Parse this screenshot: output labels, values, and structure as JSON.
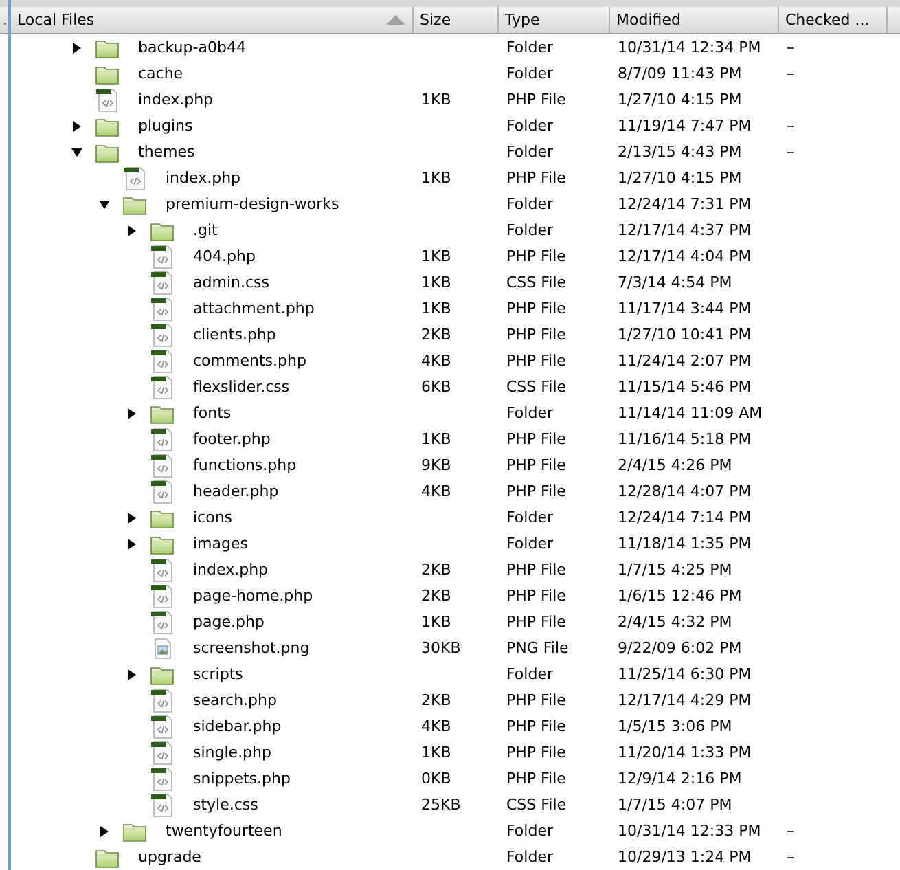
{
  "left_pane": {
    "header": "."
  },
  "columns": [
    {
      "label": "Local Files",
      "sorted": true
    },
    {
      "label": "Size",
      "sorted": false
    },
    {
      "label": "Type",
      "sorted": false
    },
    {
      "label": "Modified",
      "sorted": false
    },
    {
      "label": "Checked ...",
      "sorted": false
    }
  ],
  "tree": [
    {
      "name": "backup-a0b44",
      "kind": "folder",
      "expanded": false,
      "type": "Folder",
      "modified": "10/31/14 12:34 PM",
      "checked": "–"
    },
    {
      "name": "cache",
      "kind": "folder",
      "type": "Folder",
      "modified": "8/7/09 11:43 PM",
      "checked": "–"
    },
    {
      "name": "index.php",
      "kind": "code",
      "size": "1KB",
      "type": "PHP File",
      "modified": "1/27/10 4:15 PM"
    },
    {
      "name": "plugins",
      "kind": "folder",
      "expanded": false,
      "type": "Folder",
      "modified": "11/19/14 7:47 PM",
      "checked": "–"
    },
    {
      "name": "themes",
      "kind": "folder",
      "expanded": true,
      "type": "Folder",
      "modified": "2/13/15 4:43 PM",
      "checked": "–",
      "children": [
        {
          "name": "index.php",
          "kind": "code",
          "size": "1KB",
          "type": "PHP File",
          "modified": "1/27/10 4:15 PM"
        },
        {
          "name": "premium-design-works",
          "kind": "folder",
          "expanded": true,
          "type": "Folder",
          "modified": "12/24/14 7:31 PM",
          "children": [
            {
              "name": ".git",
              "kind": "folder",
              "expanded": false,
              "type": "Folder",
              "modified": "12/17/14 4:37 PM"
            },
            {
              "name": "404.php",
              "kind": "code",
              "size": "1KB",
              "type": "PHP File",
              "modified": "12/17/14 4:04 PM"
            },
            {
              "name": "admin.css",
              "kind": "code",
              "size": "1KB",
              "type": "CSS File",
              "modified": "7/3/14 4:54 PM"
            },
            {
              "name": "attachment.php",
              "kind": "code",
              "size": "1KB",
              "type": "PHP File",
              "modified": "11/17/14 3:44 PM"
            },
            {
              "name": "clients.php",
              "kind": "code",
              "size": "2KB",
              "type": "PHP File",
              "modified": "1/27/10 10:41 PM"
            },
            {
              "name": "comments.php",
              "kind": "code",
              "size": "4KB",
              "type": "PHP File",
              "modified": "11/24/14 2:07 PM"
            },
            {
              "name": "flexslider.css",
              "kind": "code",
              "size": "6KB",
              "type": "CSS File",
              "modified": "11/15/14 5:46 PM"
            },
            {
              "name": "fonts",
              "kind": "folder",
              "expanded": false,
              "type": "Folder",
              "modified": "11/14/14 11:09 AM"
            },
            {
              "name": "footer.php",
              "kind": "code",
              "size": "1KB",
              "type": "PHP File",
              "modified": "11/16/14 5:18 PM"
            },
            {
              "name": "functions.php",
              "kind": "code",
              "size": "9KB",
              "type": "PHP File",
              "modified": "2/4/15 4:26 PM"
            },
            {
              "name": "header.php",
              "kind": "code",
              "size": "4KB",
              "type": "PHP File",
              "modified": "12/28/14 4:07 PM"
            },
            {
              "name": "icons",
              "kind": "folder",
              "expanded": false,
              "type": "Folder",
              "modified": "12/24/14 7:14 PM"
            },
            {
              "name": "images",
              "kind": "folder",
              "expanded": false,
              "type": "Folder",
              "modified": "11/18/14 1:35 PM"
            },
            {
              "name": "index.php",
              "kind": "code",
              "size": "2KB",
              "type": "PHP File",
              "modified": "1/7/15 4:25 PM"
            },
            {
              "name": "page-home.php",
              "kind": "code",
              "size": "2KB",
              "type": "PHP File",
              "modified": "1/6/15 12:46 PM"
            },
            {
              "name": "page.php",
              "kind": "code",
              "size": "1KB",
              "type": "PHP File",
              "modified": "2/4/15 4:32 PM"
            },
            {
              "name": "screenshot.png",
              "kind": "image",
              "size": "30KB",
              "type": "PNG File",
              "modified": "9/22/09 6:02 PM"
            },
            {
              "name": "scripts",
              "kind": "folder",
              "expanded": false,
              "type": "Folder",
              "modified": "11/25/14 6:30 PM"
            },
            {
              "name": "search.php",
              "kind": "code",
              "size": "2KB",
              "type": "PHP File",
              "modified": "12/17/14 4:29 PM"
            },
            {
              "name": "sidebar.php",
              "kind": "code",
              "size": "4KB",
              "type": "PHP File",
              "modified": "1/5/15 3:06 PM"
            },
            {
              "name": "single.php",
              "kind": "code",
              "size": "1KB",
              "type": "PHP File",
              "modified": "11/20/14 1:33 PM"
            },
            {
              "name": "snippets.php",
              "kind": "code",
              "size": "0KB",
              "type": "PHP File",
              "modified": "12/9/14 2:16 PM"
            },
            {
              "name": "style.css",
              "kind": "code",
              "size": "25KB",
              "type": "CSS File",
              "modified": "1/7/15 4:07 PM"
            }
          ]
        },
        {
          "name": "twentyfourteen",
          "kind": "folder",
          "expanded": false,
          "type": "Folder",
          "modified": "10/31/14 12:33 PM",
          "checked": "–"
        }
      ]
    },
    {
      "name": "upgrade",
      "kind": "folder",
      "type": "Folder",
      "modified": "10/29/13 1:24 PM",
      "checked": "–"
    }
  ]
}
